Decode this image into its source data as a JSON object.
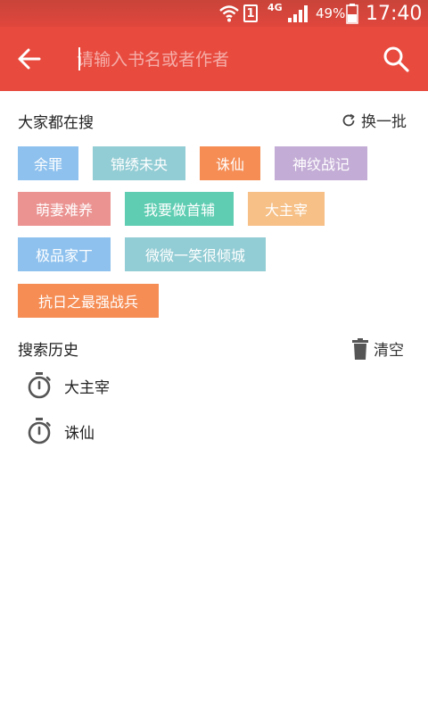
{
  "status_bar": {
    "network": "4G",
    "sim": "1",
    "battery_percent": "49%",
    "time": "17:40"
  },
  "toolbar": {
    "back_icon": "arrow-left-icon",
    "search_placeholder": "请输入书名或者作者",
    "search_value": "",
    "search_icon": "search-icon",
    "background_color": "#e84a3e"
  },
  "hot": {
    "title": "大家都在搜",
    "refresh_label": "换一批",
    "tags": [
      {
        "label": "余罪",
        "color": "#8ec1ee"
      },
      {
        "label": "锦绣未央",
        "color": "#92ccd4"
      },
      {
        "label": "诛仙",
        "color": "#f58d55"
      },
      {
        "label": "神纹战记",
        "color": "#c3acd5"
      },
      {
        "label": "萌妻难养",
        "color": "#ea9391"
      },
      {
        "label": "我要做首辅",
        "color": "#5fcdb2"
      },
      {
        "label": "大主宰",
        "color": "#f6c087"
      },
      {
        "label": "极品家丁",
        "color": "#8ec1ee"
      },
      {
        "label": "微微一笑很倾城",
        "color": "#92ccd4"
      },
      {
        "label": "抗日之最强战兵",
        "color": "#f58d55"
      }
    ]
  },
  "history": {
    "title": "搜索历史",
    "clear_label": "清空",
    "items": [
      {
        "label": "大主宰"
      },
      {
        "label": "诛仙"
      }
    ]
  }
}
